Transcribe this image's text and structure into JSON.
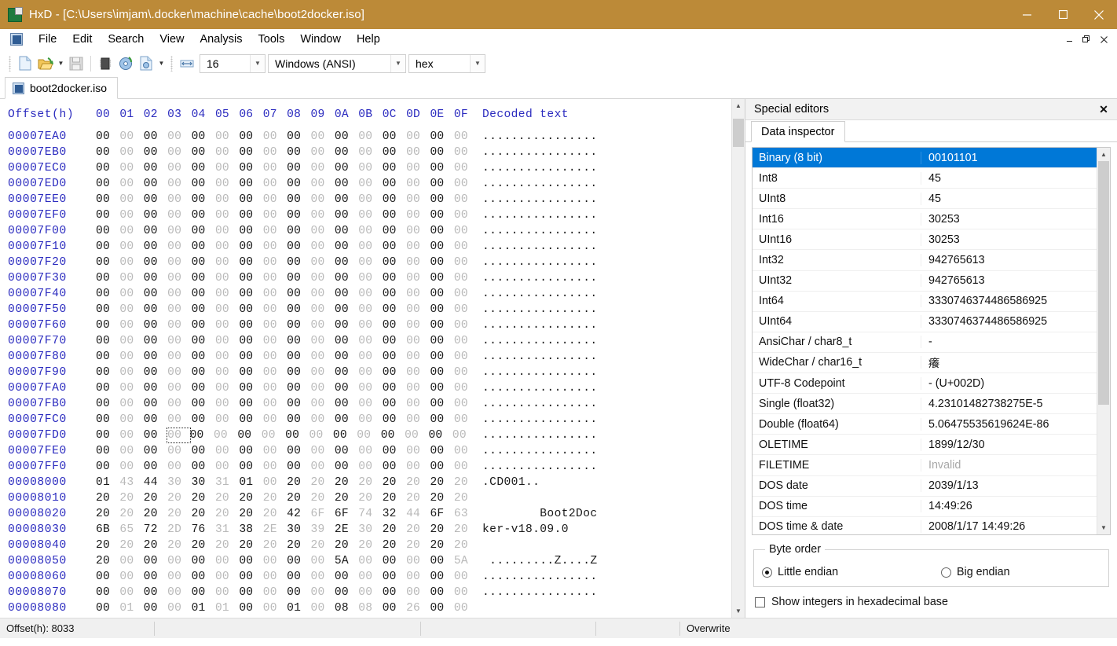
{
  "window": {
    "app_name": "HxD",
    "title": "HxD - [C:\\Users\\imjam\\.docker\\machine\\cache\\boot2docker.iso]",
    "titlebar_color": "#bc8a38",
    "minimize_label": "—",
    "maximize_label": "□",
    "close_label": "✕",
    "mdi_minimize": "–",
    "mdi_restore": "❐",
    "mdi_close": "✕"
  },
  "menu": {
    "items": [
      {
        "label": "File"
      },
      {
        "label": "Edit"
      },
      {
        "label": "Search"
      },
      {
        "label": "View"
      },
      {
        "label": "Analysis"
      },
      {
        "label": "Tools"
      },
      {
        "label": "Window"
      },
      {
        "label": "Help"
      }
    ]
  },
  "toolbar": {
    "new_icon": "new-document-icon",
    "open_icon": "open-folder-icon",
    "save_icon": "save-disk-icon",
    "ram_icon": "open-ram-icon",
    "disk_icon": "open-disk-icon",
    "diskimage_icon": "open-disk-image-icon",
    "bytes_per_row_icon": "bytes-per-row-icon",
    "bytes_per_row": "16",
    "encoding": "Windows (ANSI)",
    "offset_base": "hex",
    "dropdown_glyph": "⌄"
  },
  "document_tab": {
    "label": "boot2docker.iso"
  },
  "hex": {
    "header": {
      "offset_label": "Offset(h)",
      "columns": [
        "00",
        "01",
        "02",
        "03",
        "04",
        "05",
        "06",
        "07",
        "08",
        "09",
        "0A",
        "0B",
        "0C",
        "0D",
        "0E",
        "0F"
      ],
      "text_label": "Decoded text"
    },
    "cursor": {
      "offset": "00008033",
      "byte": "2D",
      "row_index": 19,
      "col_index": 3
    },
    "rows": [
      {
        "offset": "00007EA0",
        "bytes": [
          "00",
          "00",
          "00",
          "00",
          "00",
          "00",
          "00",
          "00",
          "00",
          "00",
          "00",
          "00",
          "00",
          "00",
          "00",
          "00"
        ],
        "text": "................"
      },
      {
        "offset": "00007EB0",
        "bytes": [
          "00",
          "00",
          "00",
          "00",
          "00",
          "00",
          "00",
          "00",
          "00",
          "00",
          "00",
          "00",
          "00",
          "00",
          "00",
          "00"
        ],
        "text": "................"
      },
      {
        "offset": "00007EC0",
        "bytes": [
          "00",
          "00",
          "00",
          "00",
          "00",
          "00",
          "00",
          "00",
          "00",
          "00",
          "00",
          "00",
          "00",
          "00",
          "00",
          "00"
        ],
        "text": "................"
      },
      {
        "offset": "00007ED0",
        "bytes": [
          "00",
          "00",
          "00",
          "00",
          "00",
          "00",
          "00",
          "00",
          "00",
          "00",
          "00",
          "00",
          "00",
          "00",
          "00",
          "00"
        ],
        "text": "................"
      },
      {
        "offset": "00007EE0",
        "bytes": [
          "00",
          "00",
          "00",
          "00",
          "00",
          "00",
          "00",
          "00",
          "00",
          "00",
          "00",
          "00",
          "00",
          "00",
          "00",
          "00"
        ],
        "text": "................"
      },
      {
        "offset": "00007EF0",
        "bytes": [
          "00",
          "00",
          "00",
          "00",
          "00",
          "00",
          "00",
          "00",
          "00",
          "00",
          "00",
          "00",
          "00",
          "00",
          "00",
          "00"
        ],
        "text": "................"
      },
      {
        "offset": "00007F00",
        "bytes": [
          "00",
          "00",
          "00",
          "00",
          "00",
          "00",
          "00",
          "00",
          "00",
          "00",
          "00",
          "00",
          "00",
          "00",
          "00",
          "00"
        ],
        "text": "................"
      },
      {
        "offset": "00007F10",
        "bytes": [
          "00",
          "00",
          "00",
          "00",
          "00",
          "00",
          "00",
          "00",
          "00",
          "00",
          "00",
          "00",
          "00",
          "00",
          "00",
          "00"
        ],
        "text": "................"
      },
      {
        "offset": "00007F20",
        "bytes": [
          "00",
          "00",
          "00",
          "00",
          "00",
          "00",
          "00",
          "00",
          "00",
          "00",
          "00",
          "00",
          "00",
          "00",
          "00",
          "00"
        ],
        "text": "................"
      },
      {
        "offset": "00007F30",
        "bytes": [
          "00",
          "00",
          "00",
          "00",
          "00",
          "00",
          "00",
          "00",
          "00",
          "00",
          "00",
          "00",
          "00",
          "00",
          "00",
          "00"
        ],
        "text": "................"
      },
      {
        "offset": "00007F40",
        "bytes": [
          "00",
          "00",
          "00",
          "00",
          "00",
          "00",
          "00",
          "00",
          "00",
          "00",
          "00",
          "00",
          "00",
          "00",
          "00",
          "00"
        ],
        "text": "................"
      },
      {
        "offset": "00007F50",
        "bytes": [
          "00",
          "00",
          "00",
          "00",
          "00",
          "00",
          "00",
          "00",
          "00",
          "00",
          "00",
          "00",
          "00",
          "00",
          "00",
          "00"
        ],
        "text": "................"
      },
      {
        "offset": "00007F60",
        "bytes": [
          "00",
          "00",
          "00",
          "00",
          "00",
          "00",
          "00",
          "00",
          "00",
          "00",
          "00",
          "00",
          "00",
          "00",
          "00",
          "00"
        ],
        "text": "................"
      },
      {
        "offset": "00007F70",
        "bytes": [
          "00",
          "00",
          "00",
          "00",
          "00",
          "00",
          "00",
          "00",
          "00",
          "00",
          "00",
          "00",
          "00",
          "00",
          "00",
          "00"
        ],
        "text": "................"
      },
      {
        "offset": "00007F80",
        "bytes": [
          "00",
          "00",
          "00",
          "00",
          "00",
          "00",
          "00",
          "00",
          "00",
          "00",
          "00",
          "00",
          "00",
          "00",
          "00",
          "00"
        ],
        "text": "................"
      },
      {
        "offset": "00007F90",
        "bytes": [
          "00",
          "00",
          "00",
          "00",
          "00",
          "00",
          "00",
          "00",
          "00",
          "00",
          "00",
          "00",
          "00",
          "00",
          "00",
          "00"
        ],
        "text": "................"
      },
      {
        "offset": "00007FA0",
        "bytes": [
          "00",
          "00",
          "00",
          "00",
          "00",
          "00",
          "00",
          "00",
          "00",
          "00",
          "00",
          "00",
          "00",
          "00",
          "00",
          "00"
        ],
        "text": "................"
      },
      {
        "offset": "00007FB0",
        "bytes": [
          "00",
          "00",
          "00",
          "00",
          "00",
          "00",
          "00",
          "00",
          "00",
          "00",
          "00",
          "00",
          "00",
          "00",
          "00",
          "00"
        ],
        "text": "................"
      },
      {
        "offset": "00007FC0",
        "bytes": [
          "00",
          "00",
          "00",
          "00",
          "00",
          "00",
          "00",
          "00",
          "00",
          "00",
          "00",
          "00",
          "00",
          "00",
          "00",
          "00"
        ],
        "text": "................"
      },
      {
        "offset": "00007FD0",
        "bytes": [
          "00",
          "00",
          "00",
          "00",
          "00",
          "00",
          "00",
          "00",
          "00",
          "00",
          "00",
          "00",
          "00",
          "00",
          "00",
          "00"
        ],
        "text": "................"
      },
      {
        "offset": "00007FE0",
        "bytes": [
          "00",
          "00",
          "00",
          "00",
          "00",
          "00",
          "00",
          "00",
          "00",
          "00",
          "00",
          "00",
          "00",
          "00",
          "00",
          "00"
        ],
        "text": "................"
      },
      {
        "offset": "00007FF0",
        "bytes": [
          "00",
          "00",
          "00",
          "00",
          "00",
          "00",
          "00",
          "00",
          "00",
          "00",
          "00",
          "00",
          "00",
          "00",
          "00",
          "00"
        ],
        "text": "................"
      },
      {
        "offset": "00008000",
        "bytes": [
          "01",
          "43",
          "44",
          "30",
          "30",
          "31",
          "01",
          "00",
          "20",
          "20",
          "20",
          "20",
          "20",
          "20",
          "20",
          "20"
        ],
        "text": ".CD001.."
      },
      {
        "offset": "00008010",
        "bytes": [
          "20",
          "20",
          "20",
          "20",
          "20",
          "20",
          "20",
          "20",
          "20",
          "20",
          "20",
          "20",
          "20",
          "20",
          "20",
          "20"
        ],
        "text": ""
      },
      {
        "offset": "00008020",
        "bytes": [
          "20",
          "20",
          "20",
          "20",
          "20",
          "20",
          "20",
          "20",
          "42",
          "6F",
          "6F",
          "74",
          "32",
          "44",
          "6F",
          "63"
        ],
        "text": "        Boot2Doc"
      },
      {
        "offset": "00008030",
        "bytes": [
          "6B",
          "65",
          "72",
          "2D",
          "76",
          "31",
          "38",
          "2E",
          "30",
          "39",
          "2E",
          "30",
          "20",
          "20",
          "20",
          "20"
        ],
        "text": "ker-v18.09.0"
      },
      {
        "offset": "00008040",
        "bytes": [
          "20",
          "20",
          "20",
          "20",
          "20",
          "20",
          "20",
          "20",
          "20",
          "20",
          "20",
          "20",
          "20",
          "20",
          "20",
          "20"
        ],
        "text": ""
      },
      {
        "offset": "00008050",
        "bytes": [
          "20",
          "00",
          "00",
          "00",
          "00",
          "00",
          "00",
          "00",
          "00",
          "00",
          "5A",
          "00",
          "00",
          "00",
          "00",
          "5A"
        ],
        "text": " .........Z....Z"
      },
      {
        "offset": "00008060",
        "bytes": [
          "00",
          "00",
          "00",
          "00",
          "00",
          "00",
          "00",
          "00",
          "00",
          "00",
          "00",
          "00",
          "00",
          "00",
          "00",
          "00"
        ],
        "text": "................"
      },
      {
        "offset": "00008070",
        "bytes": [
          "00",
          "00",
          "00",
          "00",
          "00",
          "00",
          "00",
          "00",
          "00",
          "00",
          "00",
          "00",
          "00",
          "00",
          "00",
          "00"
        ],
        "text": "................"
      },
      {
        "offset": "00008080",
        "bytes": [
          "00",
          "01",
          "00",
          "00",
          "01",
          "01",
          "00",
          "00",
          "01",
          "00",
          "08",
          "08",
          "00",
          "26",
          "00",
          "00"
        ],
        "text": ""
      }
    ]
  },
  "dock": {
    "header_title": "Special editors",
    "close_glyph": "✕",
    "tab_label": "Data inspector",
    "inspector_rows": [
      {
        "name": "Binary (8 bit)",
        "value": "00101101",
        "selected": true
      },
      {
        "name": "Int8",
        "value": "45",
        "selected": false
      },
      {
        "name": "UInt8",
        "value": "45",
        "selected": false
      },
      {
        "name": "Int16",
        "value": "30253",
        "selected": false
      },
      {
        "name": "UInt16",
        "value": "30253",
        "selected": false
      },
      {
        "name": "Int32",
        "value": "942765613",
        "selected": false
      },
      {
        "name": "UInt32",
        "value": "942765613",
        "selected": false
      },
      {
        "name": "Int64",
        "value": "3330746374486586925",
        "selected": false
      },
      {
        "name": "UInt64",
        "value": "3330746374486586925",
        "selected": false
      },
      {
        "name": "AnsiChar / char8_t",
        "value": "-",
        "selected": false
      },
      {
        "name": "WideChar / char16_t",
        "value": "癢",
        "selected": false
      },
      {
        "name": "UTF-8 Codepoint",
        "value": "- (U+002D)",
        "selected": false
      },
      {
        "name": "Single (float32)",
        "value": "4.23101482738275E-5",
        "selected": false
      },
      {
        "name": "Double (float64)",
        "value": "5.06475535619624E-86",
        "selected": false
      },
      {
        "name": "OLETIME",
        "value": "1899/12/30",
        "selected": false
      },
      {
        "name": "FILETIME",
        "value": "Invalid",
        "selected": false,
        "invalid": true
      },
      {
        "name": "DOS date",
        "value": "2039/1/13",
        "selected": false
      },
      {
        "name": "DOS time",
        "value": "14:49:26",
        "selected": false
      },
      {
        "name": "DOS time & date",
        "value": "2008/1/17 14:49:26",
        "selected": false
      }
    ],
    "byte_order": {
      "legend": "Byte order",
      "little_endian": "Little endian",
      "big_endian": "Big endian",
      "selected": "little"
    },
    "hex_base_checkbox": {
      "label": "Show integers in hexadecimal base",
      "checked": false
    }
  },
  "statusbar": {
    "offset": "Offset(h): 8033",
    "mode": "Overwrite"
  }
}
